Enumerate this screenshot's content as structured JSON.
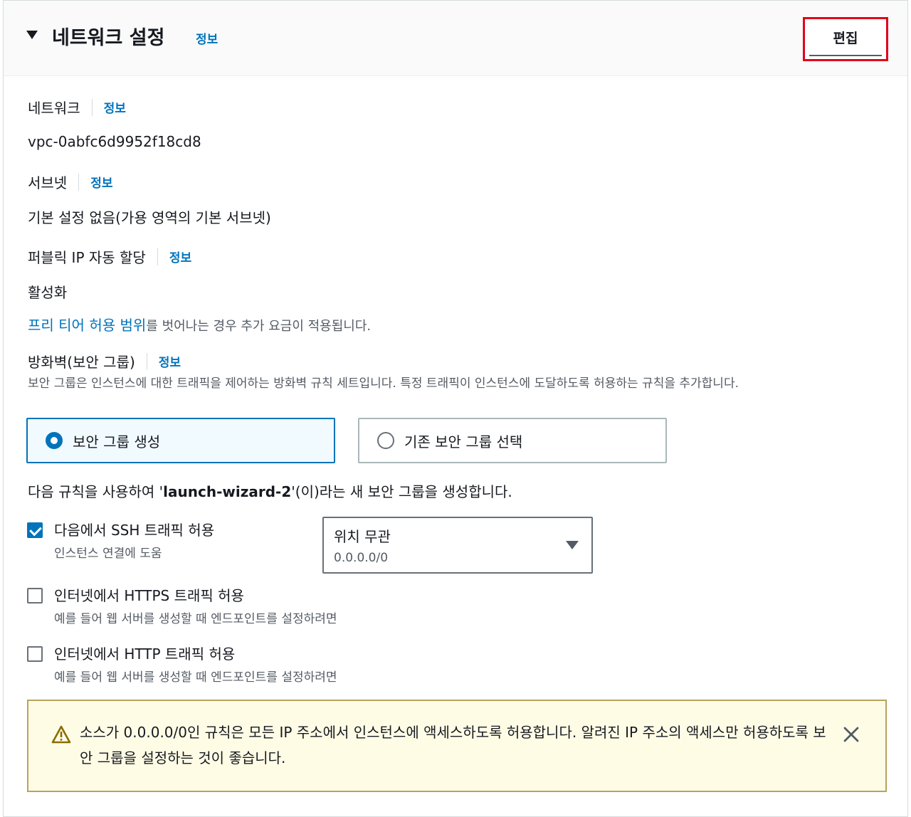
{
  "header": {
    "title": "네트워크 설정",
    "info": "정보",
    "edit_label": "편집"
  },
  "network": {
    "label": "네트워크",
    "info": "정보",
    "value": "vpc-0abfc6d9952f18cd8"
  },
  "subnet": {
    "label": "서브넷",
    "info": "정보",
    "value": "기본 설정 없음(가용 영역의 기본 서브넷)"
  },
  "public_ip": {
    "label": "퍼블릭 IP 자동 할당",
    "info": "정보",
    "value": "활성화",
    "note_link": "프리 티어 허용 범위",
    "note_rest": "를 벗어나는 경우 추가 요금이 적용됩니다."
  },
  "firewall": {
    "label": "방화벽(보안 그룹)",
    "info": "정보",
    "desc": "보안 그룹은 인스턴스에 대한 트래픽을 제어하는 방화벽 규칙 세트입니다. 특정 트래픽이 인스턴스에 도달하도록 허용하는 규칙을 추가합니다.",
    "options": [
      {
        "label": "보안 그룹 생성",
        "selected": true
      },
      {
        "label": "기존 보안 그룹 선택",
        "selected": false
      }
    ],
    "rule_prefix": "다음 규칙을 사용하여 '",
    "rule_name": "launch-wizard-2",
    "rule_suffix": "'(이)라는 새 보안 그룹을 생성합니다."
  },
  "rules": [
    {
      "label": "다음에서 SSH 트래픽 허용",
      "desc": "인스턴스 연결에 도움",
      "checked": true
    },
    {
      "label": "인터넷에서 HTTPS 트래픽 허용",
      "desc": "예를 들어 웹 서버를 생성할 때 엔드포인트를 설정하려면",
      "checked": false
    },
    {
      "label": "인터넷에서 HTTP 트래픽 허용",
      "desc": "예를 들어 웹 서버를 생성할 때 엔드포인트를 설정하려면",
      "checked": false
    }
  ],
  "ssh_source": {
    "value": "위치 무관",
    "sub": "0.0.0.0/0"
  },
  "warning": {
    "text": "소스가 0.0.0.0/0인 규칙은 모든 IP 주소에서 인스턴스에 액세스하도록 허용합니다. 알려진 IP 주소의 액세스만 허용하도록 보안 그룹을 설정하는 것이 좋습니다."
  },
  "colors": {
    "link": "#0073bb",
    "highlight": "#e0001b",
    "warning_bg": "#fffce6",
    "warning_border": "#b7a35b"
  }
}
